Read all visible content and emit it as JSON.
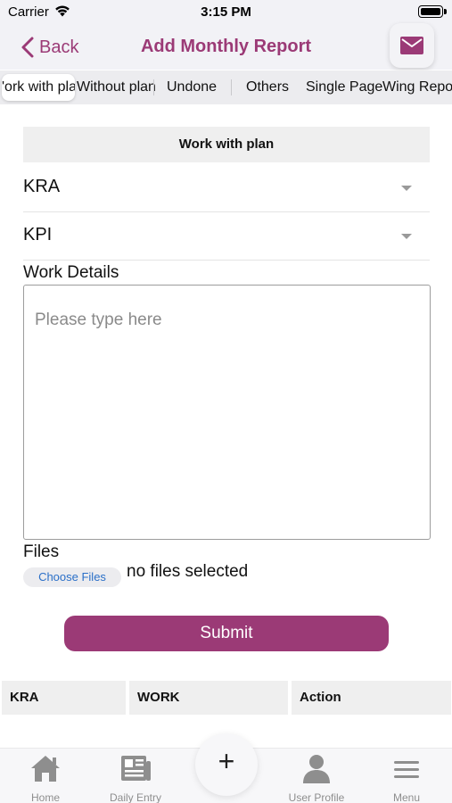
{
  "status_bar": {
    "carrier": "Carrier",
    "time": "3:15 PM"
  },
  "nav": {
    "back_label": "Back",
    "title": "Add Monthly Report",
    "mail_icon": "mail-icon"
  },
  "tabs": [
    {
      "label": "Work with plan",
      "display": "'ork with pla",
      "active": true
    },
    {
      "label": "Without plan",
      "display": "Without plan",
      "active": false
    },
    {
      "label": "Undone",
      "display": "Undone",
      "active": false
    },
    {
      "label": "Others",
      "display": "Others",
      "active": false
    },
    {
      "label": "Single Page",
      "display": "Single Page",
      "active": false
    },
    {
      "label": "Wing Report",
      "display": "Wing Repo",
      "active": false
    }
  ],
  "form": {
    "section_title": "Work with plan",
    "kra_label": "KRA",
    "kpi_label": "KPI",
    "work_details_label": "Work Details",
    "work_details_placeholder": "Please type here",
    "files_label": "Files",
    "choose_files_label": "Choose Files",
    "no_files_text": "no files selected",
    "submit_label": "Submit"
  },
  "table": {
    "columns": [
      "KRA",
      "WORK",
      "Action"
    ]
  },
  "tab_bar": {
    "items": [
      {
        "label": "Home",
        "icon": "home-icon"
      },
      {
        "label": "Daily Entry",
        "icon": "newspaper-icon"
      },
      {
        "label": "User Profile",
        "icon": "user-icon"
      },
      {
        "label": "Menu",
        "icon": "hamburger-menu-icon"
      }
    ],
    "fab_symbol": "+"
  },
  "colors": {
    "accent": "#9b3a76",
    "link": "#2a6fc8",
    "icon_gray": "#8e8e8e"
  }
}
